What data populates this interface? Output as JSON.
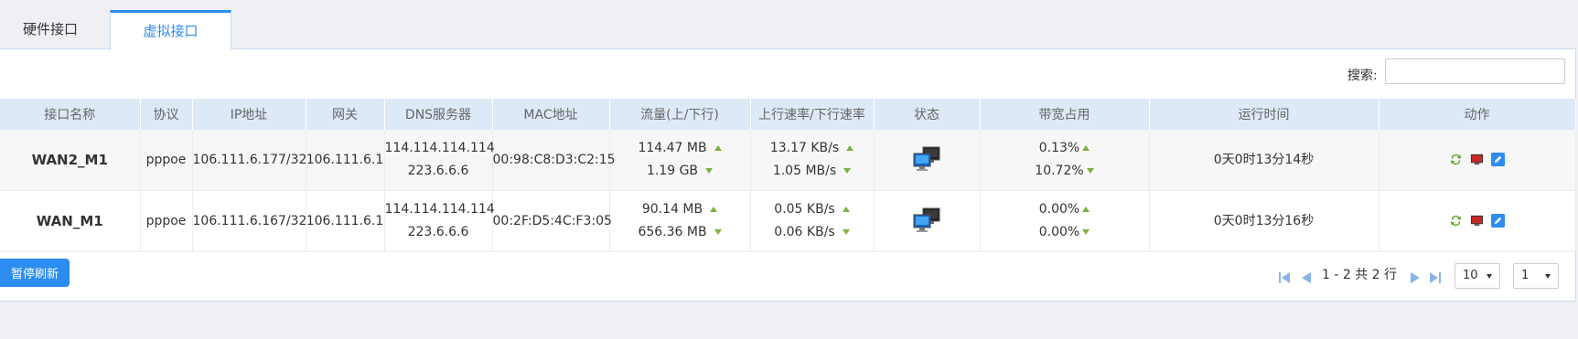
{
  "tabs": {
    "hardware": "硬件接口",
    "virtual": "虚拟接口"
  },
  "search": {
    "label": "搜索:",
    "value": ""
  },
  "columns": [
    "接口名称",
    "协议",
    "IP地址",
    "网关",
    "DNS服务器",
    "MAC地址",
    "流量(上/下行)",
    "上行速率/下行速率",
    "状态",
    "带宽占用",
    "运行时间",
    "动作"
  ],
  "rows": [
    {
      "name": "WAN2_M1",
      "protocol": "pppoe",
      "ip": "106.111.6.177/32",
      "gateway": "106.111.6.1",
      "dns1": "114.114.114.114",
      "dns2": "223.6.6.6",
      "mac": "00:98:C8:D3:C2:15",
      "traffic_up": "114.47 MB",
      "traffic_down": "1.19 GB",
      "rate_up": "13.17 KB/s",
      "rate_down": "1.05 MB/s",
      "bw_up": "0.13%",
      "bw_down": "10.72%",
      "uptime": "0天0时13分14秒"
    },
    {
      "name": "WAN_M1",
      "protocol": "pppoe",
      "ip": "106.111.6.167/32",
      "gateway": "106.111.6.1",
      "dns1": "114.114.114.114",
      "dns2": "223.6.6.6",
      "mac": "00:2F:D5:4C:F3:05",
      "traffic_up": "90.14 MB",
      "traffic_down": "656.36 MB",
      "rate_up": "0.05 KB/s",
      "rate_down": "0.06 KB/s",
      "bw_up": "0.00%",
      "bw_down": "0.00%",
      "uptime": "0天0时13分16秒"
    }
  ],
  "footer": {
    "pause_label": "暂停刷新",
    "page_info": "1 - 2 共 2 行",
    "page_size": "10",
    "page_num": "1"
  },
  "colors": {
    "accent": "#2d8cf0",
    "header_bg": "#dde9f7",
    "arrow": "#7cb342"
  },
  "icons": [
    "network-status-icon",
    "refresh-icon",
    "monitor-icon",
    "edit-icon",
    "first-page-icon",
    "prev-page-icon",
    "next-page-icon",
    "last-page-icon"
  ]
}
